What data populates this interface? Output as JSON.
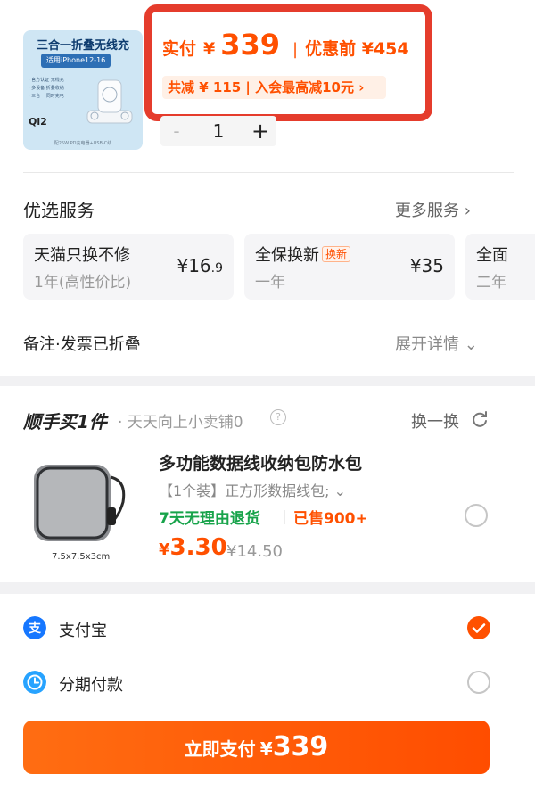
{
  "product": {
    "thumb_title": "三合一折叠无线充",
    "thumb_subtitle": "适用iPhone12-16",
    "thumb_bullets": [
      "· 官方认证 无线充",
      "· 多设备 折叠收纳",
      "· 三合一 同时充电"
    ],
    "thumb_badge": "Qi2",
    "thumb_footer": "配25W PD充电器+USB-C线",
    "quantity": "1",
    "qty_minus": "-",
    "qty_plus": "+"
  },
  "price": {
    "paid_label": "实付",
    "yen": "¥",
    "paid_value": "339",
    "separator": "|",
    "before_label": "优惠前 ¥454",
    "discount_text": "共减 ¥ 115 | 入会最高减10元 ›"
  },
  "services": {
    "title": "优选服务",
    "more_label": "更多服务 ›",
    "cards": [
      {
        "name": "天猫只换不修",
        "sub": "1年(高性价比)",
        "price_yen": "¥",
        "price_int": "16",
        "price_dec": ".9",
        "tag": ""
      },
      {
        "name": "全保换新",
        "sub": "一年",
        "price_yen": "¥",
        "price_int": "35",
        "price_dec": "",
        "tag": "换新"
      },
      {
        "name": "全面",
        "sub": "二年",
        "price_yen": "",
        "price_int": "",
        "price_dec": "",
        "tag": ""
      }
    ],
    "note_label": "备注·发票已折叠",
    "expand_label": "展开详情 ⌄"
  },
  "addon": {
    "brand": "顺手买1件",
    "shop": "· 天天向上小卖铺0",
    "info_icon": "?",
    "switch_label": "换一换",
    "image_dimensions": "7.5x7.5x3cm",
    "name": "多功能数据线收纳包防水包",
    "spec": "【1个装】正方形数据线包; ⌄",
    "return_policy": "7天无理由退货",
    "sep": "|",
    "sold": "已售900+",
    "price_yen": "¥",
    "price_value": "3.30",
    "original_price": "¥14.50"
  },
  "payment": {
    "alipay_label": "支付宝",
    "huabei_label": "分期付款",
    "selected": "alipay",
    "button_label": "立即支付",
    "button_yen": "¥",
    "button_value": "339"
  },
  "colors": {
    "accent": "#ff5000",
    "highlight_border": "#e53c2c",
    "green": "#17a34a",
    "alipay_blue": "#1677ff"
  }
}
